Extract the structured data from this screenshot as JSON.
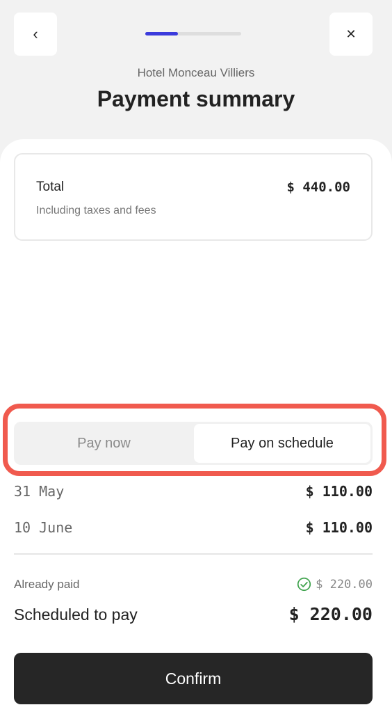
{
  "header": {
    "back_icon": "chevron-left-icon",
    "back_glyph": "‹",
    "close_icon": "close-icon",
    "close_glyph": "✕",
    "progress": 0.34,
    "progress_color": "#3b3bdc",
    "hotel_name": "Hotel Monceau Villiers",
    "title": "Payment summary"
  },
  "total_card": {
    "label": "Total",
    "value": "$ 440.00",
    "subtitle": "Including taxes and fees"
  },
  "payment_toggle": {
    "options": [
      "Pay now",
      "Pay on schedule"
    ],
    "selected": "Pay on schedule",
    "highlight_color": "#f05a4e"
  },
  "schedule": [
    {
      "date": "31 May",
      "amount": "$ 110.00"
    },
    {
      "date": "10 June",
      "amount": "$ 110.00"
    }
  ],
  "summary": {
    "already_paid_label": "Already paid",
    "already_paid_value": "$ 220.00",
    "paid_icon": "check-circle-icon",
    "paid_icon_color": "#3fa34d",
    "scheduled_label": "Scheduled to pay",
    "scheduled_value": "$ 220.00"
  },
  "confirm_label": "Confirm"
}
